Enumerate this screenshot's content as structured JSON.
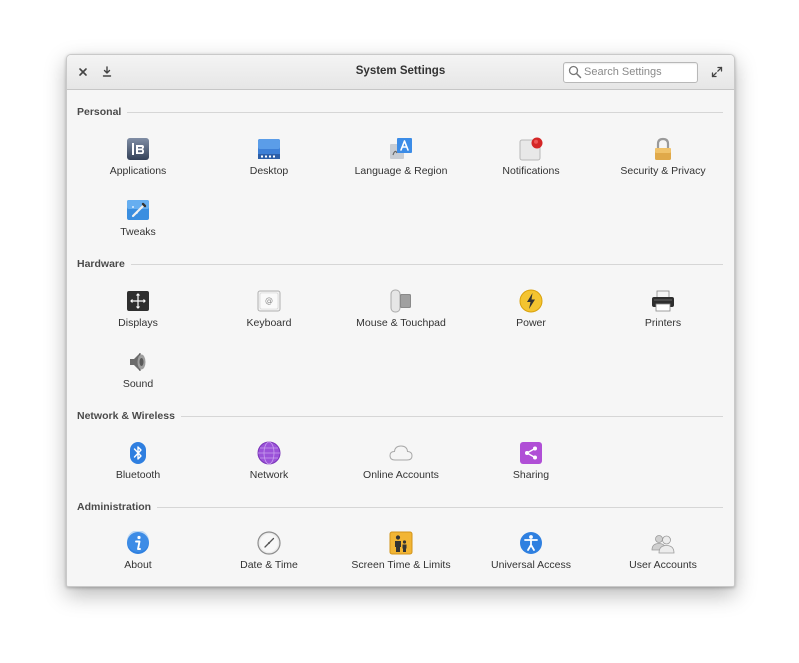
{
  "window": {
    "title": "System Settings",
    "search_placeholder": "Search Settings"
  },
  "sections": {
    "personal": {
      "label": "Personal",
      "items": [
        {
          "label": "Applications",
          "icon": "applications-icon"
        },
        {
          "label": "Desktop",
          "icon": "desktop-icon"
        },
        {
          "label": "Language & Region",
          "icon": "language-region-icon"
        },
        {
          "label": "Notifications",
          "icon": "notifications-icon"
        },
        {
          "label": "Security & Privacy",
          "icon": "lock-icon"
        },
        {
          "label": "Tweaks",
          "icon": "tweaks-icon"
        }
      ]
    },
    "hardware": {
      "label": "Hardware",
      "items": [
        {
          "label": "Displays",
          "icon": "displays-icon"
        },
        {
          "label": "Keyboard",
          "icon": "keyboard-icon"
        },
        {
          "label": "Mouse & Touchpad",
          "icon": "mouse-touchpad-icon"
        },
        {
          "label": "Power",
          "icon": "power-icon"
        },
        {
          "label": "Printers",
          "icon": "printer-icon"
        },
        {
          "label": "Sound",
          "icon": "speaker-icon"
        }
      ]
    },
    "network": {
      "label": "Network & Wireless",
      "items": [
        {
          "label": "Bluetooth",
          "icon": "bluetooth-icon"
        },
        {
          "label": "Network",
          "icon": "network-icon"
        },
        {
          "label": "Online Accounts",
          "icon": "cloud-icon"
        },
        {
          "label": "Sharing",
          "icon": "share-icon"
        }
      ]
    },
    "administration": {
      "label": "Administration",
      "items": [
        {
          "label": "About",
          "icon": "info-icon"
        },
        {
          "label": "Date & Time",
          "icon": "clock-icon"
        },
        {
          "label": "Screen Time & Limits",
          "icon": "screen-time-icon"
        },
        {
          "label": "Universal Access",
          "icon": "accessibility-icon"
        },
        {
          "label": "User Accounts",
          "icon": "user-accounts-icon"
        }
      ]
    }
  }
}
